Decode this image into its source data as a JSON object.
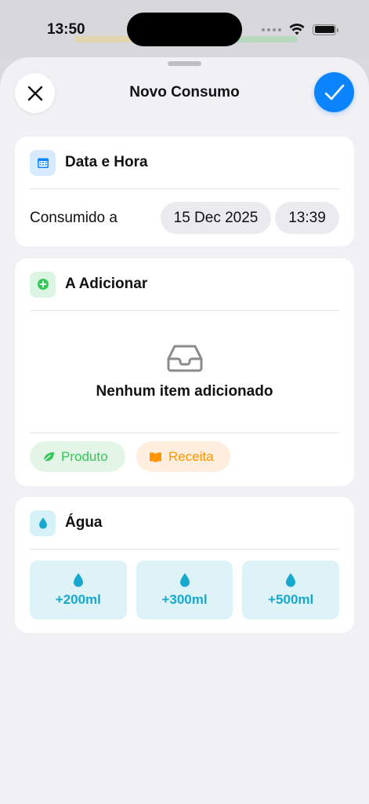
{
  "status": {
    "time": "13:50"
  },
  "header": {
    "title": "Novo Consumo",
    "close_icon": "xmark-icon",
    "confirm_icon": "checkmark-icon"
  },
  "datetime_card": {
    "title": "Data e Hora",
    "icon": "calendar-icon",
    "label": "Consumido a",
    "date": "15 Dec 2025",
    "time": "13:39"
  },
  "add_card": {
    "title": "A Adicionar",
    "icon": "plus-circle-icon",
    "empty_text": "Nenhum item adicionado",
    "empty_icon": "tray-icon",
    "produto_label": "Produto",
    "receita_label": "Receita"
  },
  "water_card": {
    "title": "Água",
    "icon": "drop-icon",
    "options": [
      "+200ml",
      "+300ml",
      "+500ml"
    ]
  },
  "colors": {
    "accent": "#0a84ff",
    "green": "#34c759",
    "orange": "#ff9500",
    "water": "#18a8cf"
  }
}
